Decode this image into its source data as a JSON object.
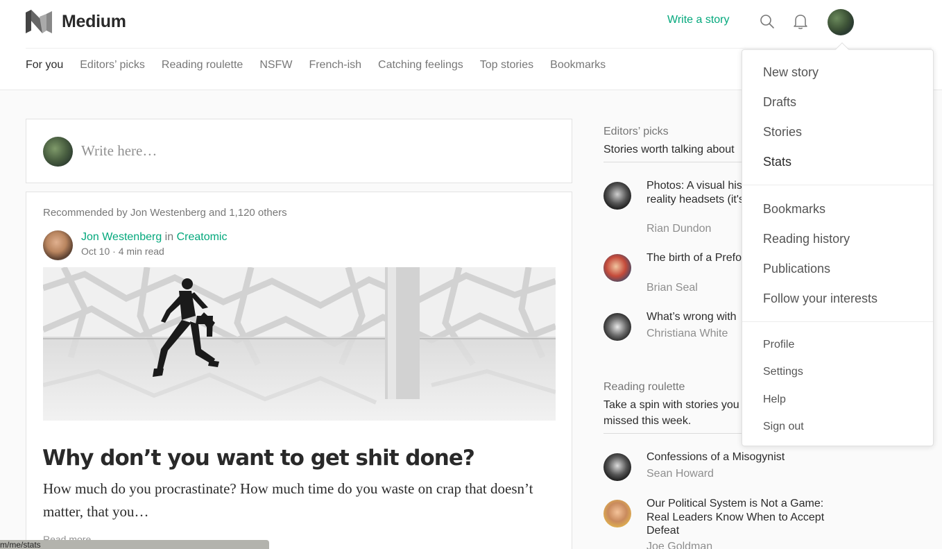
{
  "header": {
    "brand": "Medium",
    "write_story": "Write a story"
  },
  "nav": {
    "items": [
      "For you",
      "Editors’ picks",
      "Reading roulette",
      "NSFW",
      "French-ish",
      "Catching feelings",
      "Top stories",
      "Bookmarks"
    ],
    "active": "For you"
  },
  "composer": {
    "placeholder": "Write here…"
  },
  "post": {
    "recommended": "Recommended by Jon Westenberg and 1,120 others",
    "author": "Jon Westenberg",
    "in_word": "in",
    "publication": "Creatomic",
    "date": "Oct 10",
    "read_time": "4 min read",
    "title": "Why don’t you want to get shit done?",
    "excerpt": "How much do you procrastinate? How much time do you waste on crap that doesn’t matter, that you…",
    "read_more": "Read more…"
  },
  "sidebar": {
    "editors": {
      "label": "Editors’ picks",
      "subtitle": "Stories worth talking about",
      "items": [
        {
          "title": "Photos: A visual history of virtual reality headsets (it's not pretty)",
          "author": "Rian Dundon"
        },
        {
          "title": "The birth of a Prefontaine king",
          "author": "Brian Seal"
        },
        {
          "title": "What’s wrong with",
          "author": "Christiana White"
        }
      ]
    },
    "roulette": {
      "label": "Reading roulette",
      "subtitle": "Take a spin with stories you missed this week.",
      "items": [
        {
          "title": "Confessions of a Misogynist",
          "author": "Sean Howard"
        },
        {
          "title": "Our Political System is Not a Game: Real Leaders Know When to Accept Defeat",
          "author": "Joe Goldman"
        }
      ]
    }
  },
  "dropdown": {
    "group1": [
      "New story",
      "Drafts",
      "Stories",
      "Stats"
    ],
    "group2": [
      "Bookmarks",
      "Reading history",
      "Publications",
      "Follow your interests"
    ],
    "group3": [
      "Profile",
      "Settings",
      "Help",
      "Sign out"
    ]
  },
  "statusbar": {
    "url": "m/me/stats"
  },
  "colors": {
    "accent_green": "#03a87c",
    "background": "#fafafa"
  }
}
